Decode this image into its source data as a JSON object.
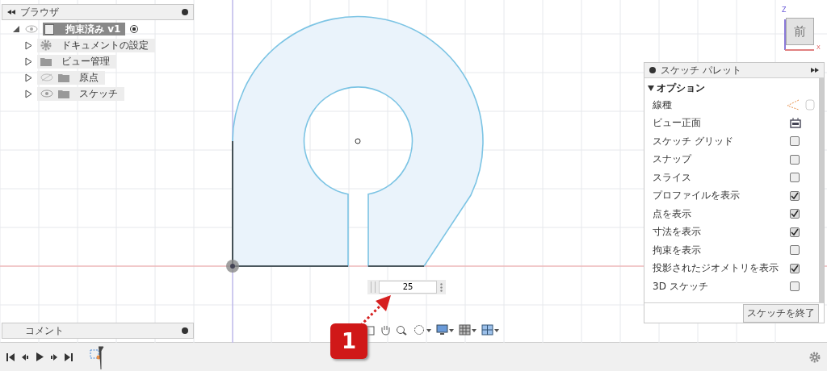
{
  "browser": {
    "title": "ブラウザ",
    "root": {
      "label": "拘束済み v1"
    },
    "items": [
      {
        "label": "ドキュメントの設定",
        "kind": "settings"
      },
      {
        "label": "ビュー管理",
        "kind": "folder"
      },
      {
        "label": "原点",
        "kind": "hidden-folder"
      },
      {
        "label": "スケッチ",
        "kind": "visible-folder"
      }
    ]
  },
  "view_cube": {
    "face": "前",
    "z_label": "Z",
    "x_label": "X"
  },
  "dimension_input": {
    "value": "25"
  },
  "callout": {
    "label": "1"
  },
  "palette": {
    "title": "スケッチ パレット",
    "section": {
      "label": "オプション",
      "expanded": true
    },
    "rows": [
      {
        "kind": "linetype",
        "label": "線種"
      },
      {
        "kind": "action",
        "label": "ビュー正面"
      },
      {
        "kind": "checkbox",
        "label": "スケッチ グリッド",
        "checked": false
      },
      {
        "kind": "checkbox",
        "label": "スナップ",
        "checked": false
      },
      {
        "kind": "checkbox",
        "label": "スライス",
        "checked": false
      },
      {
        "kind": "checkbox",
        "label": "プロファイルを表示",
        "checked": true
      },
      {
        "kind": "checkbox",
        "label": "点を表示",
        "checked": true
      },
      {
        "kind": "checkbox",
        "label": "寸法を表示",
        "checked": true
      },
      {
        "kind": "checkbox",
        "label": "拘束を表示",
        "checked": false
      },
      {
        "kind": "checkbox",
        "label": "投影されたジオメトリを表示",
        "checked": true
      },
      {
        "kind": "checkbox",
        "label": "3D スケッチ",
        "checked": false
      }
    ],
    "finish_button": "スケッチを終了"
  },
  "comments": {
    "title": "コメント"
  }
}
